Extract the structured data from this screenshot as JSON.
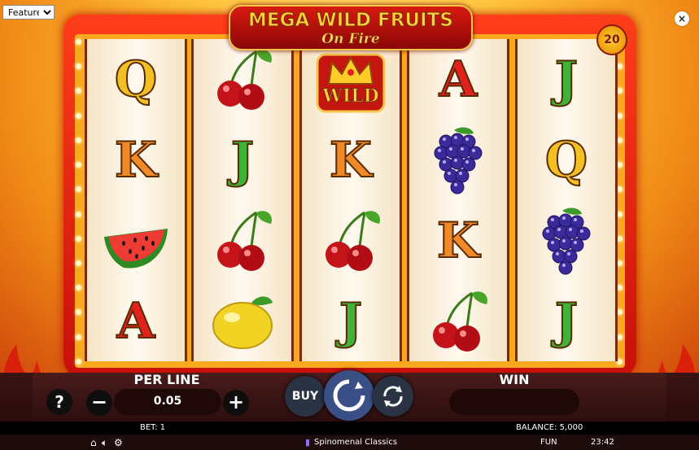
{
  "top": {
    "features_select": "Features",
    "close_label": "×"
  },
  "title": {
    "main": "MEGA WILD FRUITS",
    "sub": "On Fire"
  },
  "lines_badge": "20",
  "reels": [
    [
      "Q",
      "K",
      "watermelon",
      "A"
    ],
    [
      "cherries",
      "J",
      "cherries",
      "lemon"
    ],
    [
      "wild",
      "K",
      "cherries",
      "J"
    ],
    [
      "A",
      "grapes",
      "K",
      "cherries"
    ],
    [
      "J",
      "Q",
      "grapes",
      "J"
    ]
  ],
  "wild_label": "WILD",
  "controls": {
    "help": "?",
    "per_line_label": "PER LINE",
    "bet_value": "0.05",
    "minus": "−",
    "plus": "+",
    "buy": "BUY",
    "win_label": "WIN"
  },
  "status": {
    "bet": "BET: 1",
    "balance": "BALANCE: 5,000"
  },
  "footer": {
    "brand": "Spinomenal Classics",
    "mode": "FUN",
    "time": "23:42"
  },
  "colors": {
    "frame": "#c8100a",
    "spin_button": "#3a4f85",
    "gold": "#ffd23a"
  }
}
